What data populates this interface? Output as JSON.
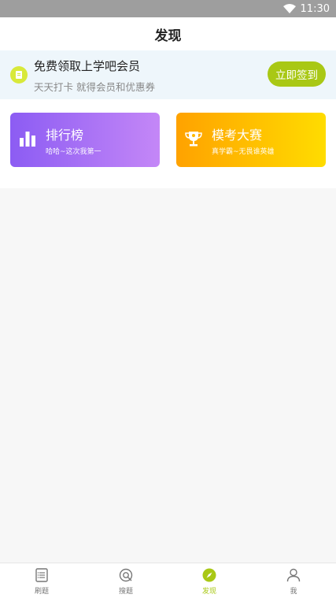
{
  "status_bar": {
    "time": "11:30"
  },
  "header": {
    "title": "发现"
  },
  "checkin": {
    "title": "免费领取上学吧会员",
    "subtitle": "天天打卡 就得会员和优惠券",
    "button_label": "立即签到"
  },
  "cards": {
    "ranking": {
      "title": "排行榜",
      "subtitle": "哈哈~这次我第一"
    },
    "exam": {
      "title": "模考大赛",
      "subtitle": "真学霸~无畏谁英雄"
    }
  },
  "tabs": [
    {
      "label": "刷题",
      "icon": "list-icon"
    },
    {
      "label": "搜题",
      "icon": "search-icon"
    },
    {
      "label": "发现",
      "icon": "compass-icon",
      "active": true
    },
    {
      "label": "我",
      "icon": "user-icon"
    }
  ],
  "colors": {
    "accent": "#a9c815",
    "ranking_start": "#8c5cf3",
    "ranking_end": "#c487f7",
    "exam_start": "#ffa200",
    "exam_end": "#ffdc00"
  }
}
